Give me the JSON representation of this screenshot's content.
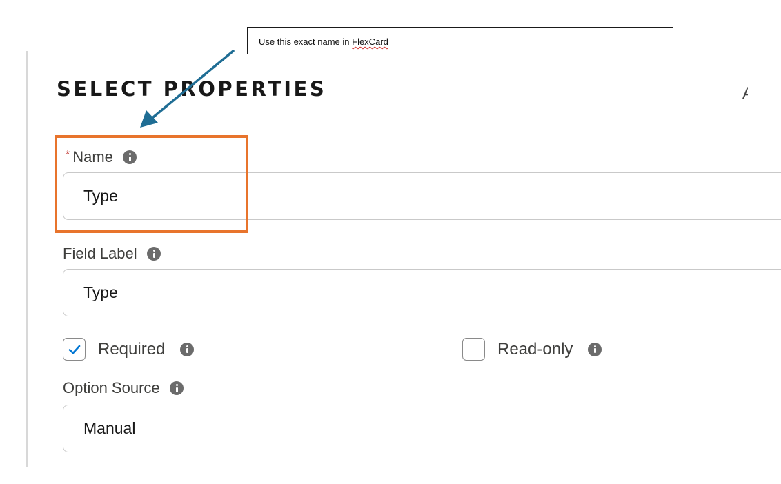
{
  "annotation": {
    "note_prefix": "Use this exact name in ",
    "note_flagged_word": "FlexCard",
    "highlight_color": "#e8742c",
    "arrow_color": "#1f6d94"
  },
  "section": {
    "title": "SELECT PROPERTIES",
    "cut_off_text": "A"
  },
  "fields": {
    "name": {
      "label": "Name",
      "required_marker": "*",
      "value": "Type",
      "info_icon": "info-icon"
    },
    "field_label": {
      "label": "Field Label",
      "value": "Type",
      "info_icon": "info-icon"
    },
    "required": {
      "label": "Required",
      "checked": true
    },
    "read_only": {
      "label": "Read-only",
      "checked": false
    },
    "option_source": {
      "label": "Option Source",
      "value": "Manual",
      "info_icon": "info-icon"
    }
  },
  "colors": {
    "required_star": "#c23934",
    "checkbox_check": "#0176d3"
  }
}
